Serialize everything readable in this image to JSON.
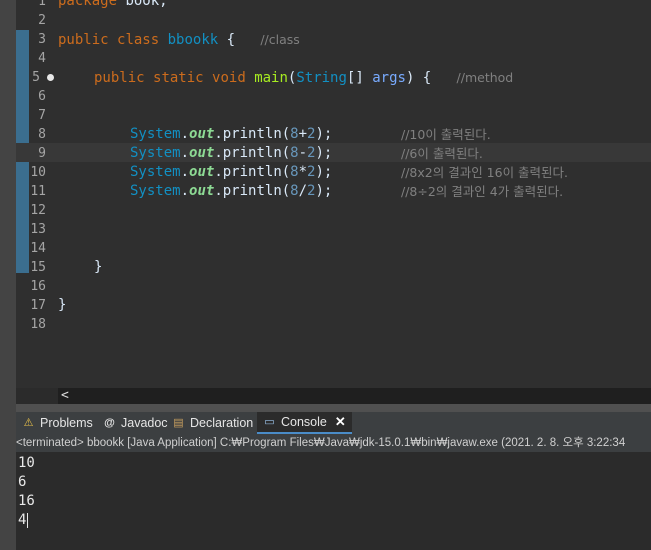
{
  "editor": {
    "line_numbers": [
      "1",
      "2",
      "3",
      "4",
      "5",
      "6",
      "7",
      "8",
      "9",
      "10",
      "11",
      "12",
      "13",
      "14",
      "15",
      "16",
      "17",
      "18"
    ],
    "package_kw": "package",
    "package_name": " book;",
    "class_kw1": "public",
    "class_kw2": "class",
    "class_name": "bbookk",
    "class_brace": " {",
    "class_comment": "//class",
    "method_kw1": "public",
    "method_kw2": "static",
    "method_kw3": "void",
    "method_name": "main",
    "method_open": "(",
    "param_type": "String",
    "param_mid": "[] ",
    "param_name": "args",
    "method_close": ") {",
    "method_comment": "//method",
    "stmts": [
      {
        "cls": "System",
        "dot": ".",
        "out": "out",
        "call": ".println(",
        "a": "8",
        "op": "+",
        "b": "2",
        "end": ");",
        "comment": "//10이 출력된다."
      },
      {
        "cls": "System",
        "dot": ".",
        "out": "out",
        "call": ".println(",
        "a": "8",
        "op": "-",
        "b": "2",
        "end": ");",
        "comment": "//6이 출력된다."
      },
      {
        "cls": "System",
        "dot": ".",
        "out": "out",
        "call": ".println(",
        "a": "8",
        "op": "*",
        "b": "2",
        "end": ");",
        "comment": "//8x2의 결과인 16이 출력된다."
      },
      {
        "cls": "System",
        "dot": ".",
        "out": "out",
        "call": ".println(",
        "a": "8",
        "op": "/",
        "b": "2",
        "end": ");",
        "comment": "//8÷2의 결과인 4가 출력된다."
      }
    ],
    "close_brace_method": "}",
    "close_brace_class": "}",
    "scroll_left": "<"
  },
  "tabs": [
    {
      "label": "Problems",
      "icon": "problems-icon",
      "glyph": "⚠"
    },
    {
      "label": "Javadoc",
      "icon": "javadoc-icon",
      "glyph": "@"
    },
    {
      "label": "Declaration",
      "icon": "declaration-icon",
      "glyph": "▤"
    },
    {
      "label": "Console",
      "icon": "console-icon",
      "glyph": "▭"
    }
  ],
  "console": {
    "status": "<terminated> bbookk [Java Application] C:₩Program Files₩Java₩jdk-15.0.1₩bin₩javaw.exe  (2021. 2. 8. 오후 3:22:34",
    "output": [
      "10",
      "6",
      "16",
      "4"
    ]
  },
  "colors": {
    "editor_bg": "#2f2f2f",
    "keyword": "#cc6c1d",
    "class": "#1290c3",
    "method": "#a7ec21",
    "comment": "#808080",
    "accent": "#4a8cc8"
  }
}
